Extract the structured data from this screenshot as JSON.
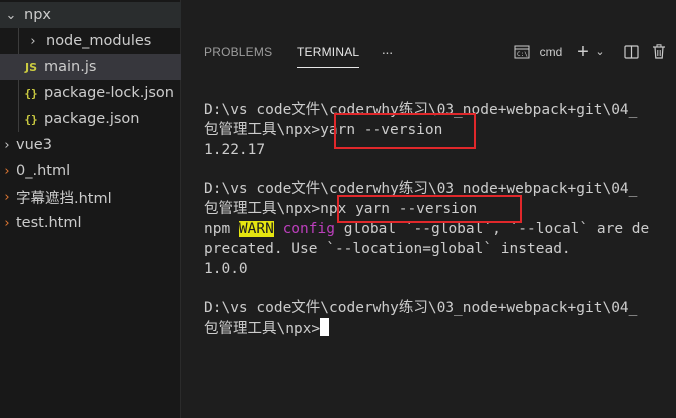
{
  "sidebar": {
    "items": [
      {
        "label": "npx",
        "kind": "folder-open"
      },
      {
        "label": "node_modules",
        "kind": "folder-closed"
      },
      {
        "label": "main.js",
        "kind": "js"
      },
      {
        "label": "package-lock.json",
        "kind": "json"
      },
      {
        "label": "package.json",
        "kind": "json"
      },
      {
        "label": "vue3",
        "kind": "folder-closed"
      },
      {
        "label": "0_.html",
        "kind": "html"
      },
      {
        "label": "字幕遮挡.html",
        "kind": "html"
      },
      {
        "label": "test.html",
        "kind": "html"
      }
    ],
    "js_badge": "JS",
    "json_badge": "{}"
  },
  "panel": {
    "tabs": [
      "PROBLEMS",
      "TERMINAL"
    ],
    "more": "···",
    "terminal_name": "cmd"
  },
  "terminal": {
    "lines": [
      "D:\\vs code文件\\coderwhy练习\\03_node+webpack+git\\04_",
      "包管理工具\\npx>yarn --version",
      "1.22.17",
      "",
      "D:\\vs code文件\\coderwhy练习\\03_node+webpack+git\\04_",
      "包管理工具\\npx>npx yarn --version",
      "npm ",
      "precated. Use `--location=global` instead.",
      "1.0.0",
      "",
      "D:\\vs code文件\\coderwhy练习\\03_node+webpack+git\\04_",
      "包管理工具\\npx>"
    ],
    "warn_tag": "WARN",
    "config_word": "config",
    "warn_rest": " global `--global`, `--local` are de"
  },
  "colors": {
    "warn_bg": "#e5e510",
    "config": "#bc3fbc",
    "highlight_box": "#e0282b"
  }
}
